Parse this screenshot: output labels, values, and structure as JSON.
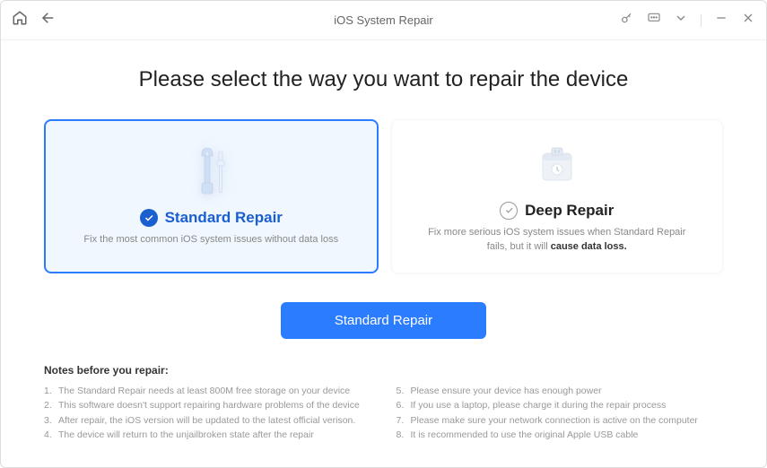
{
  "titlebar": {
    "title": "iOS System Repair"
  },
  "heading": "Please select the way you want to repair the device",
  "options": {
    "standard": {
      "title": "Standard Repair",
      "desc": "Fix the most common iOS system issues without data loss"
    },
    "deep": {
      "title": "Deep Repair",
      "desc_prefix": "Fix more serious iOS system issues when Standard Repair fails, but it will ",
      "desc_bold": "cause data loss."
    }
  },
  "action_button": "Standard Repair",
  "notes": {
    "heading": "Notes before you repair:",
    "left": [
      "The Standard Repair needs at least 800M free storage on your device",
      "This software doesn't support repairing hardware problems of the device",
      "After repair, the iOS version will be updated to the latest official verison.",
      "The device will return to the unjailbroken state after the repair"
    ],
    "right": [
      "Please ensure your device has enough power",
      "If you use a laptop, please charge it during the repair process",
      "Please make sure your network connection is active on the computer",
      "It is recommended to use the original Apple USB cable"
    ]
  }
}
